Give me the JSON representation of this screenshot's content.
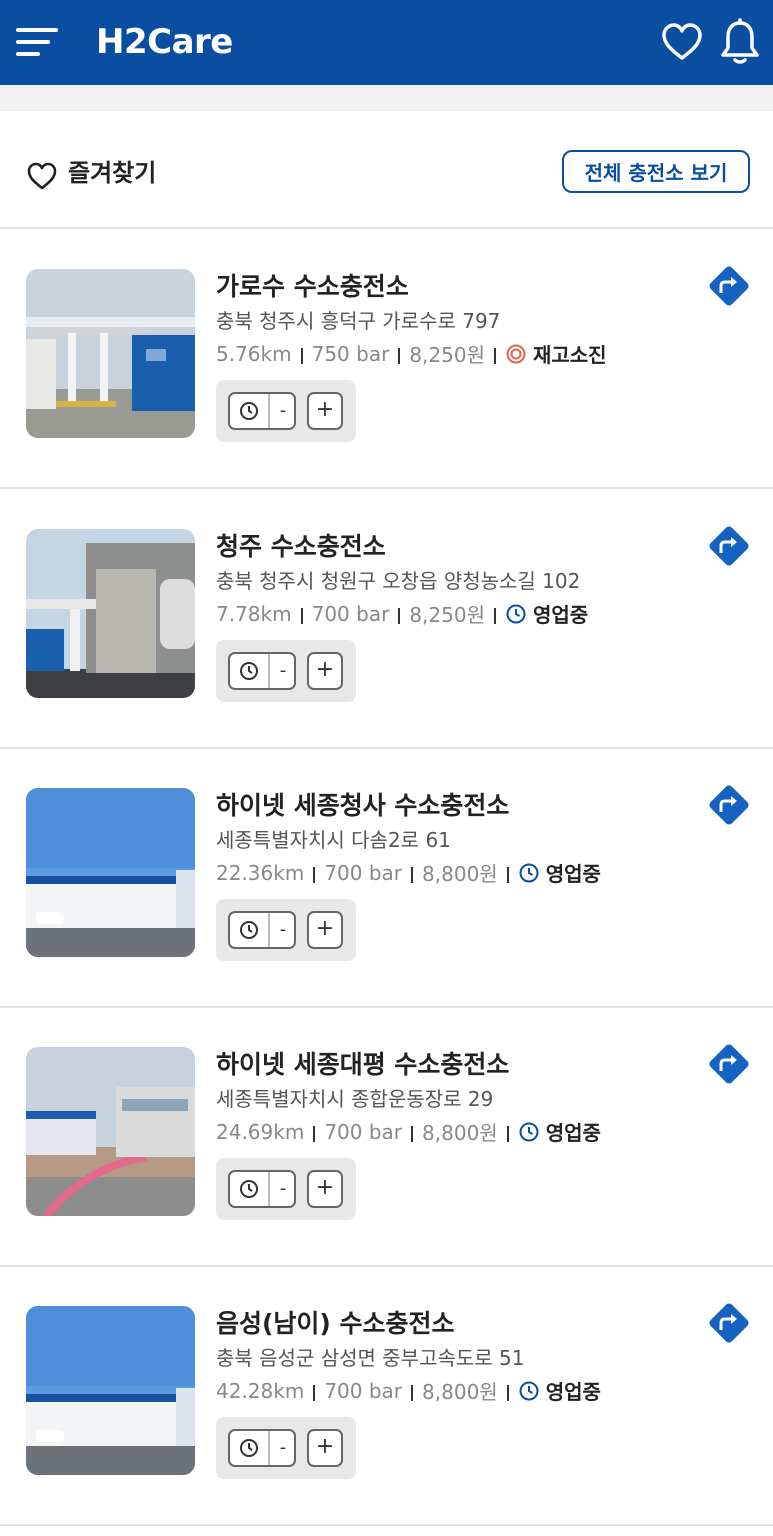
{
  "header": {
    "logo_text": "H2Care",
    "menu_icon": "hamburger-menu-icon",
    "favorites_icon": "heart-icon",
    "notifications_icon": "bell-icon",
    "background_color": "#0a4ea2"
  },
  "favorites": {
    "title": "즐겨찾기",
    "view_all_label": "전체 충전소 보기"
  },
  "stations": [
    {
      "name": "가로수 수소충전소",
      "address": "충북 청주시 흥덕구 가로수로 797",
      "distance": "5.76km",
      "pressure": "750 bar",
      "price": "8,250원",
      "status": "재고소진",
      "status_icon": "out-of-stock-icon",
      "status_color": "#e0654a"
    },
    {
      "name": "청주 수소충전소",
      "address": "충북 청주시 청원구 오창읍 양청농소길 102",
      "distance": "7.78km",
      "pressure": "700 bar",
      "price": "8,250원",
      "status": "영업중",
      "status_icon": "clock-icon",
      "status_color": "#0a4ea2"
    },
    {
      "name": "하이넷 세종청사 수소충전소",
      "address": "세종특별자치시 다솜2로 61",
      "distance": "22.36km",
      "pressure": "700 bar",
      "price": "8,800원",
      "status": "영업중",
      "status_icon": "clock-icon",
      "status_color": "#0a4ea2"
    },
    {
      "name": "하이넷 세종대평 수소충전소",
      "address": "세종특별자치시 종합운동장로 29",
      "distance": "24.69km",
      "pressure": "700 bar",
      "price": "8,800원",
      "status": "영업중",
      "status_icon": "clock-icon",
      "status_color": "#0a4ea2"
    },
    {
      "name": "음성(남이) 수소충전소",
      "address": "충북 음성군 삼성면 중부고속도로 51",
      "distance": "42.28km",
      "pressure": "700 bar",
      "price": "8,800원",
      "status": "영업중",
      "status_icon": "clock-icon",
      "status_color": "#0a4ea2"
    }
  ],
  "controls": {
    "minus_label": "-",
    "plus_label": "+"
  }
}
